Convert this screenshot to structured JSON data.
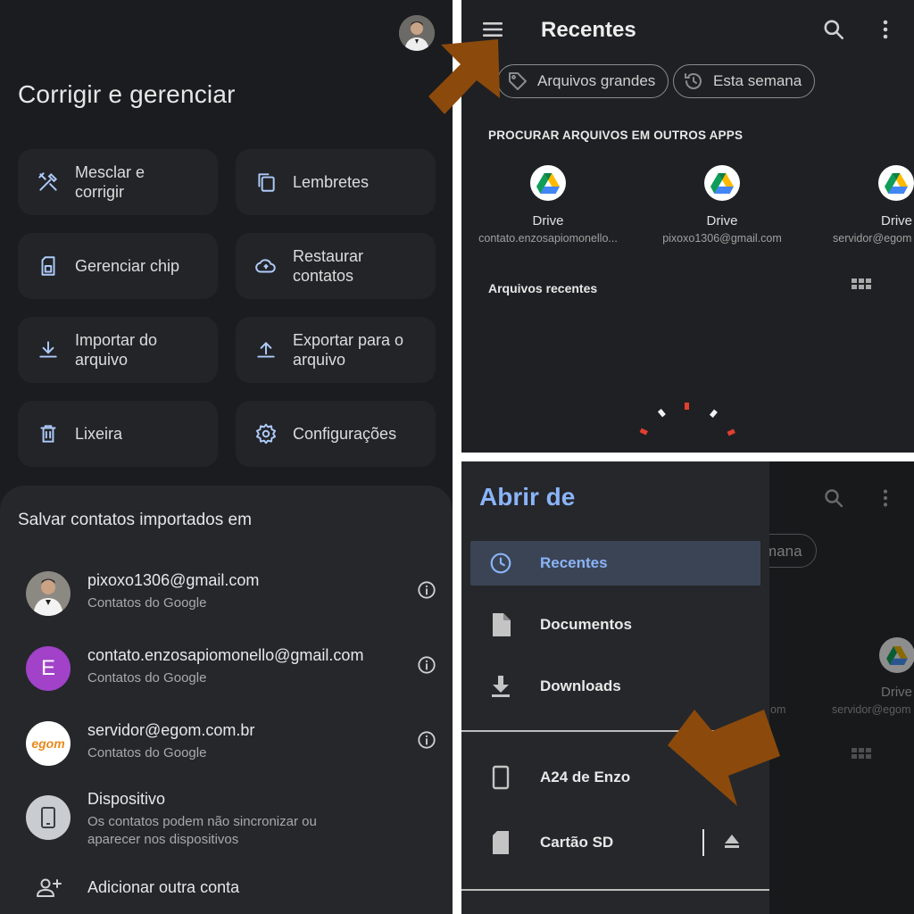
{
  "left_panel": {
    "page_title": "Corrigir e gerenciar",
    "tiles": [
      {
        "label": "Mesclar e\ncorrigir",
        "icon": "tools-icon"
      },
      {
        "label": "Lembretes",
        "icon": "copy-icon"
      },
      {
        "label": "Gerenciar chip",
        "icon": "sim-card-icon"
      },
      {
        "label": "Restaurar\ncontatos",
        "icon": "cloud-upload-icon"
      },
      {
        "label": "Importar do\narquivo",
        "icon": "download-icon"
      },
      {
        "label": "Exportar para o\narquivo",
        "icon": "upload-icon"
      },
      {
        "label": "Lixeira",
        "icon": "trash-icon"
      },
      {
        "label": "Configurações",
        "icon": "gear-icon"
      }
    ],
    "sheet": {
      "title": "Salvar contatos importados em",
      "accounts": [
        {
          "email": "pixoxo1306@gmail.com",
          "sub": "Contatos do Google"
        },
        {
          "email": "contato.enzosapiomonello@gmail.com",
          "sub": "Contatos do Google",
          "initial": "E"
        },
        {
          "email": "servidor@egom.com.br",
          "sub": "Contatos do Google",
          "logo_text": "egom"
        },
        {
          "email": "Dispositivo",
          "sub": "Os contatos podem não sincronizar ou\naparecer nos dispositivos"
        }
      ],
      "add_account": "Adicionar outra conta"
    }
  },
  "recentes_panel": {
    "title": "Recentes",
    "chips": [
      "Arquivos grandes",
      "Esta semana"
    ],
    "section_title": "PROCURAR ARQUIVOS EM OUTROS APPS",
    "drives": [
      {
        "name": "Drive",
        "account": "contato.enzosapiomonello..."
      },
      {
        "name": "Drive",
        "account": "pixoxo1306@gmail.com"
      },
      {
        "name": "Drive",
        "account": "servidor@egom"
      }
    ],
    "recent_files_label": "Arquivos recentes"
  },
  "drawer_panel": {
    "title": "Abrir de",
    "items": [
      {
        "label": "Recentes",
        "icon": "clock-icon",
        "active": true
      },
      {
        "label": "Documentos",
        "icon": "document-icon"
      },
      {
        "label": "Downloads",
        "icon": "download-icon"
      },
      {
        "label": "A24 de Enzo",
        "icon": "phone-icon"
      },
      {
        "label": "Cartão SD",
        "icon": "sd-card-icon"
      }
    ],
    "background_chip_fragment": "mana",
    "background_drive_name": "Drive",
    "background_drive_account": "servidor@egom",
    "background_fragment_om": "om"
  },
  "colors": {
    "accent_blue": "#8ab4f8",
    "active_item_bg": "#3b4454",
    "arrow_brown": "#8b4a0b",
    "avatar_purple": "#a142c9"
  }
}
